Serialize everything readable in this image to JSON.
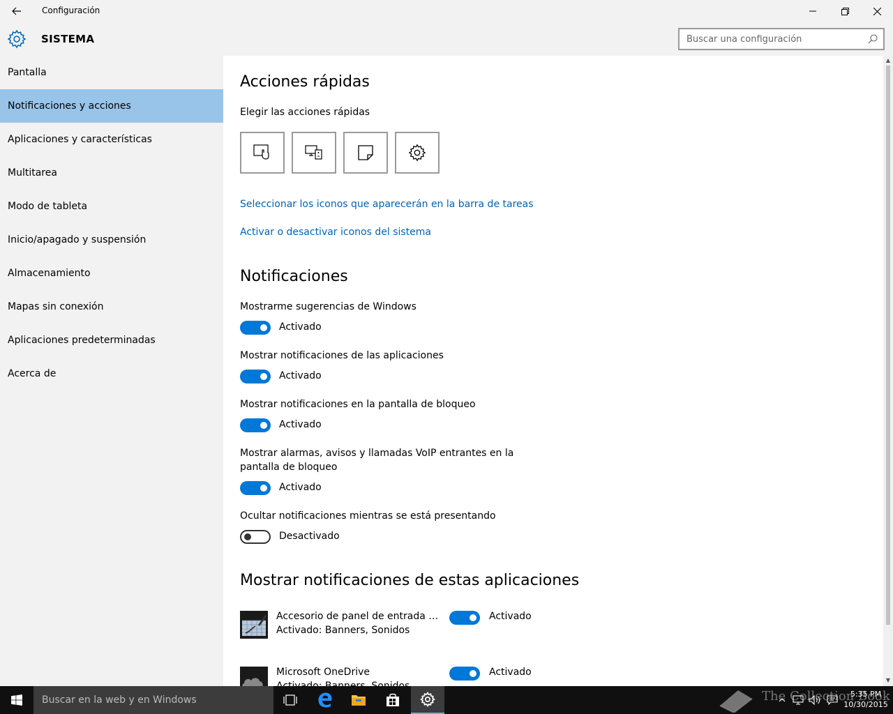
{
  "window": {
    "title": "Configuración"
  },
  "header": {
    "section": "SISTEMA",
    "search_placeholder": "Buscar una configuración"
  },
  "sidebar": {
    "items": [
      {
        "label": "Pantalla",
        "active": false
      },
      {
        "label": "Notificaciones y acciones",
        "active": true
      },
      {
        "label": "Aplicaciones y características",
        "active": false
      },
      {
        "label": "Multitarea",
        "active": false
      },
      {
        "label": "Modo de tableta",
        "active": false
      },
      {
        "label": "Inicio/apagado y suspensión",
        "active": false
      },
      {
        "label": "Almacenamiento",
        "active": false
      },
      {
        "label": "Mapas sin conexión",
        "active": false
      },
      {
        "label": "Aplicaciones predeterminadas",
        "active": false
      },
      {
        "label": "Acerca de",
        "active": false
      }
    ]
  },
  "quick_actions": {
    "title": "Acciones rápidas",
    "subtitle": "Elegir las acciones rápidas",
    "tiles": [
      "tablet-mode-icon",
      "project-icon",
      "note-icon",
      "settings-icon"
    ],
    "link_taskbar_icons": "Seleccionar los iconos que aparecerán en la barra de tareas",
    "link_system_icons": "Activar o desactivar iconos del sistema"
  },
  "notifications": {
    "title": "Notificaciones",
    "settings": [
      {
        "label": "Mostrarme sugerencias de Windows",
        "state": "Activado",
        "on": true
      },
      {
        "label": "Mostrar notificaciones de las aplicaciones",
        "state": "Activado",
        "on": true
      },
      {
        "label": "Mostrar notificaciones en la pantalla de bloqueo",
        "state": "Activado",
        "on": true
      },
      {
        "label": "Mostrar alarmas, avisos y llamadas VoIP entrantes en la pantalla de bloqueo",
        "state": "Activado",
        "on": true
      },
      {
        "label": "Ocultar notificaciones mientras se está presentando",
        "state": "Desactivado",
        "on": false
      }
    ]
  },
  "apps": {
    "title": "Mostrar notificaciones de estas aplicaciones",
    "items": [
      {
        "name": "Accesorio de panel de entrada ma...",
        "detail": "Activado: Banners, Sonidos",
        "state": "Activado"
      },
      {
        "name": "Microsoft OneDrive",
        "detail": "Activado: Banners, Sonidos",
        "state": "Activado"
      }
    ]
  },
  "taskbar": {
    "search_placeholder": "Buscar en la web y en Windows",
    "time": "5:35 PM",
    "date": "10/30/2015",
    "watermark": "The Collection Book"
  },
  "colors": {
    "accent": "#0078d7",
    "link": "#0063b1",
    "selected_nav": "#99c4ea",
    "chrome": "#f2f2f2"
  }
}
